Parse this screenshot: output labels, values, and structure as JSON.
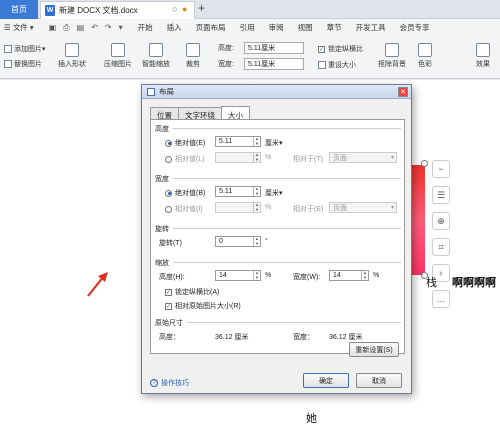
{
  "tabs": {
    "home": "首页",
    "document": "新建 DOCX 文档.docx"
  },
  "menu": {
    "file": "文件",
    "items": [
      "开始",
      "插入",
      "页面布局",
      "引用",
      "审阅",
      "视图",
      "章节",
      "开发工具",
      "会员专享"
    ]
  },
  "toolbar": {
    "add_picture": "添加图片",
    "replace_picture": "替换图片",
    "insert_shape": "插入形状",
    "compress_picture": "压缩图片",
    "smart_zoom": "智能缩放",
    "crop": "裁剪",
    "height_label": "高度:",
    "height_value": "5.11厘米",
    "width_label": "宽度:",
    "width_value": "5.11厘米",
    "lock_ratio": "锁定纵横比",
    "reset_size": "重设大小",
    "remove_bg": "抠除背景",
    "color": "色彩",
    "effect": "效果"
  },
  "dialog": {
    "title": "布局",
    "tabs": [
      "位置",
      "文字环绕",
      "大小"
    ],
    "active_tab": "大小",
    "height_section": "高度",
    "absolute_height_label": "绝对值(E)",
    "absolute_height_value": "5.11",
    "unit_cm": "厘米",
    "relative_height_label": "相对值(L)",
    "percent": "%",
    "relative_to_label_1": "相对于(T)",
    "relative_to_value_1": "页面",
    "width_section": "宽度",
    "absolute_width_label": "绝对值(B)",
    "absolute_width_value": "5.11",
    "relative_width_label": "相对值(I)",
    "relative_to_label_2": "相对于(E)",
    "relative_to_value_2": "页面",
    "rotate_section": "旋转",
    "rotate_label": "旋转(T)",
    "rotate_value": "0",
    "degree": "°",
    "scale_section": "缩放",
    "scale_height_label": "高度(H):",
    "scale_height_value": "14",
    "scale_width_label": "宽度(W):",
    "scale_width_value": "14",
    "lock_ratio_label": "锁定纵横比(A)",
    "relative_original_label": "相对原始图片大小(R)",
    "original_size_section": "原始尺寸",
    "orig_height_label": "高度：",
    "orig_height_value": "36.12 厘米",
    "orig_width_label": "宽度：",
    "orig_width_value": "36.12 厘米",
    "reset_button": "重新设置(S)",
    "tips": "操作技巧",
    "ok": "确定",
    "cancel": "取消"
  },
  "document": {
    "body_text": "啊啊啊啊",
    "fragment": "栈",
    "bottom_text": "她"
  },
  "colors": {
    "accent": "#3b7bd6",
    "image_red": "#f0332d"
  }
}
